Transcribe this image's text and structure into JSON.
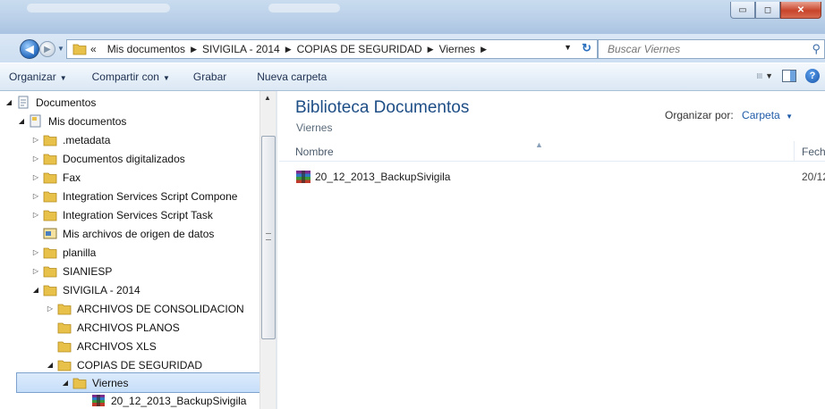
{
  "window": {
    "minimize_label": "▭",
    "maximize_label": "◻",
    "close_label": "✕"
  },
  "nav": {
    "breadcrumb": [
      "Mis documentos",
      "SIVIGILA - 2014",
      "COPIAS DE SEGURIDAD",
      "Viernes"
    ],
    "overflow_label": "«",
    "search_placeholder": "Buscar Viernes"
  },
  "toolbar": {
    "organize": "Organizar",
    "share": "Compartir con",
    "burn": "Grabar",
    "new_folder": "Nueva carpeta"
  },
  "tree": [
    {
      "label": "Documentos",
      "level": 0,
      "expanded": true,
      "icon": "library-doc-icon"
    },
    {
      "label": "Mis documentos",
      "level": 1,
      "expanded": true,
      "icon": "document-icon"
    },
    {
      "label": ".metadata",
      "level": 2,
      "expanded": false,
      "icon": "folder-icon"
    },
    {
      "label": "Documentos digitalizados",
      "level": 2,
      "expanded": false,
      "icon": "folder-icon"
    },
    {
      "label": "Fax",
      "level": 2,
      "expanded": false,
      "icon": "folder-icon"
    },
    {
      "label": "Integration Services Script Compone",
      "level": 2,
      "expanded": false,
      "icon": "folder-icon"
    },
    {
      "label": "Integration Services Script Task",
      "level": 2,
      "expanded": false,
      "icon": "folder-icon"
    },
    {
      "label": "Mis archivos de origen de datos",
      "level": 2,
      "expanded": null,
      "icon": "data-source-icon"
    },
    {
      "label": "planilla",
      "level": 2,
      "expanded": false,
      "icon": "folder-icon"
    },
    {
      "label": "SIANIESP",
      "level": 2,
      "expanded": false,
      "icon": "folder-icon"
    },
    {
      "label": "SIVIGILA - 2014",
      "level": 2,
      "expanded": true,
      "icon": "folder-icon"
    },
    {
      "label": "ARCHIVOS DE CONSOLIDACION",
      "level": 3,
      "expanded": false,
      "icon": "folder-icon"
    },
    {
      "label": "ARCHIVOS PLANOS",
      "level": 3,
      "expanded": null,
      "icon": "folder-icon"
    },
    {
      "label": "ARCHIVOS XLS",
      "level": 3,
      "expanded": null,
      "icon": "folder-icon"
    },
    {
      "label": "COPIAS DE SEGURIDAD",
      "level": 3,
      "expanded": true,
      "icon": "folder-icon"
    },
    {
      "label": "Viernes",
      "level": 4,
      "expanded": true,
      "icon": "folder-icon",
      "selected": true
    },
    {
      "label": "20_12_2013_BackupSivigila",
      "level": 5,
      "expanded": null,
      "icon": "winrar-archive-icon"
    }
  ],
  "content": {
    "library_title": "Biblioteca Documentos",
    "library_subtitle": "Viernes",
    "arrange_label": "Organizar por:",
    "arrange_value": "Carpeta",
    "col_name": "Nombre",
    "col_date": "Fech",
    "files": [
      {
        "name": "20_12_2013_BackupSivigila",
        "date": "20/12",
        "icon": "winrar-archive-icon"
      }
    ]
  },
  "colors": {
    "title_gradient": "#b9cfe8",
    "accent_blue": "#1e4e86",
    "link_blue": "#1e5aa8",
    "folder_yellow": "#e8c14a",
    "selection_bg": "#c6def9"
  }
}
